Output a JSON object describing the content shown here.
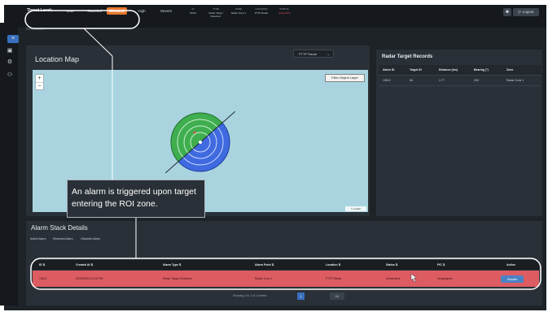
{
  "topbar": {
    "threat_label": "Threat Level:",
    "threat_levels": [
      "Low",
      "Guarded",
      "Elevated",
      "High",
      "Severe"
    ],
    "active_level": "Elevated",
    "ticker_headers": [
      "ID",
      "TYPE",
      "ZONE",
      "LOCATION",
      "STATUS"
    ],
    "ticker_values": [
      "19512",
      "Radar Target Detection",
      "Radar Zone 1",
      "PTTP Radar",
      "Unhandled"
    ],
    "user_icon": "person-icon",
    "logout_label": "[+ Logout"
  },
  "sidebar": {
    "items": [
      "dashboard-icon",
      "folder-icon",
      "settings-icon",
      "users-icon"
    ]
  },
  "breadcrumb": "Dashboard",
  "location_map": {
    "title": "Location Map",
    "select_value": "PTTP Radar",
    "filter_button": "Filter Object Layer",
    "zoom_in": "+",
    "zoom_out": "−",
    "credit": "© Leaflet"
  },
  "radar_records": {
    "title": "Radar Target Records",
    "columns": [
      "Alarm ID",
      "Target ID",
      "Distance (km)",
      "Bearing (°)",
      "Zone"
    ],
    "rows": [
      [
        "19512",
        "56",
        "1.77",
        "205",
        "Radar Zone 1"
      ]
    ]
  },
  "alarm_stack": {
    "title": "Alarm Stack Details",
    "tabs": [
      "Active Alarm",
      "Resolved Alarm",
      "Obsolete Alarm"
    ],
    "columns": [
      "ID ⇅",
      "Created At ⇅",
      "Alarm Type ⇅",
      "Alarm Point ⇅",
      "Location ⇅",
      "Status ⇅",
      "PIC ⇅",
      "Action"
    ],
    "rows": [
      {
        "id": "19512",
        "created_at": "02/06/2024 01:25 PM",
        "alarm_type": "Radar Target Detection",
        "alarm_point": "Radar Zone 1",
        "location": "PTTP Radar",
        "status": "Unhandled",
        "pic": "Unassigned",
        "action": "Handle"
      }
    ],
    "pagination_text": "Showing 1 to 1 of 1 entries",
    "current_page": "1",
    "per_page": "10"
  },
  "callout": {
    "text": "An alarm is triggered upon target entering the ROI zone."
  },
  "colors": {
    "accent_orange": "#e8772e",
    "alarm_row_red": "#dc5c62",
    "map_water": "#a9d4df",
    "radar_green": "#3fae4f",
    "radar_blue": "#3f6ae0",
    "primary_blue": "#4b83c7"
  }
}
